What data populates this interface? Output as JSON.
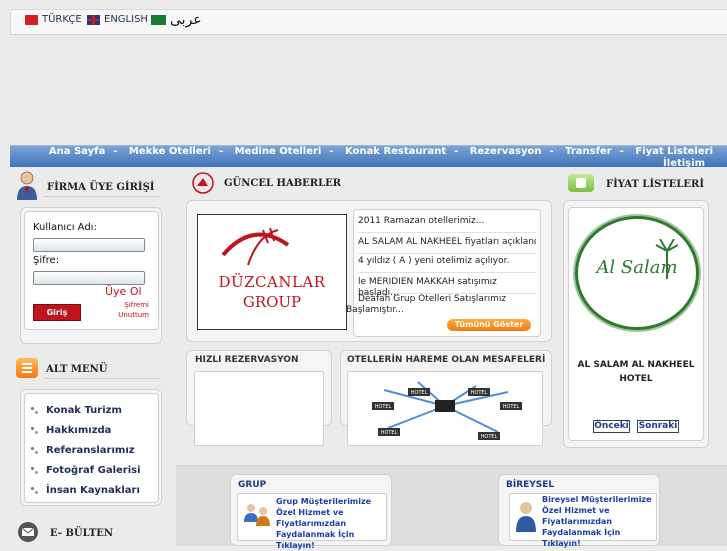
{
  "languages": [
    {
      "label": "TÜRKÇE"
    },
    {
      "label": "ENGLISH"
    },
    {
      "label": "عربى"
    }
  ],
  "nav": {
    "items": [
      "Ana Sayfa",
      "Mekke Otelleri",
      "Medine Otelleri",
      "Konak Restaurant",
      "Rezervasyon",
      "Transfer",
      "Fiyat Listeleri"
    ],
    "separator": "-",
    "last": "İletişim"
  },
  "login": {
    "title": "FİRMA ÜYE GİRİŞİ",
    "username_label": "Kullanıcı Adı:",
    "password_label": "Şifre:",
    "register_link": "Üye Ol",
    "submit_label": "Giriş",
    "forgot_line1": "Şifremi",
    "forgot_line2": "Unuttum"
  },
  "submenu": {
    "title": "ALT MENÜ",
    "items": [
      "Konak Turizm",
      "Hakkımızda",
      "Referanslarımız",
      "Fotoğraf Galerisi",
      "İnsan Kaynakları"
    ]
  },
  "newsletter": {
    "title": "E- BÜLTEN"
  },
  "news": {
    "title": "GÜNCEL HABERLER",
    "logo_line1": "DÜZCANLAR",
    "logo_line2": "GROUP",
    "items": [
      "2011 Ramazan otellerimiz...",
      "AL SALAM AL NAKHEEL fiyatları açıklandı..",
      "4 yıldız ( A ) yeni otelimiz açılıyor.",
      "le MERIDIEN MAKKAH satışımız başladı...",
      "Deafah Grup Otelleri Satışlarımız Başlamıştır..."
    ],
    "all_button": "Tümünü Göster"
  },
  "quick_reservation": {
    "title": "HIZLI REZERVASYON"
  },
  "distances": {
    "title": "OTELLERİN HAREME OLAN MESAFELERİ",
    "hotel_label": "HOTEL"
  },
  "prices": {
    "title": "FİYAT LİSTELERİ",
    "logo_text": "Al Salam",
    "hotel_name": "AL SALAM AL NAKHEEL HOTEL",
    "prev": "Önceki",
    "next": "Sonraki"
  },
  "group": {
    "title": "GRUP",
    "text": "Grup Müşterilerimize Özel Hizmet ve Fiyatlarımızdan Faydalanmak İçin Tıklayın!"
  },
  "individual": {
    "title": "BİREYSEL",
    "text": "Bireysel Müşterilerimize Özel Hizmet ve Fiyatlarımızdan Faydalanmak İçin Tıklayın!"
  },
  "colors": {
    "nav_top": "#7ca4d6",
    "nav_bottom": "#3f73b8",
    "brand_red": "#c0141d",
    "accent_orange": "#f07c10",
    "link_blue": "#1a3daa",
    "logo_green": "#2f7a2f"
  }
}
